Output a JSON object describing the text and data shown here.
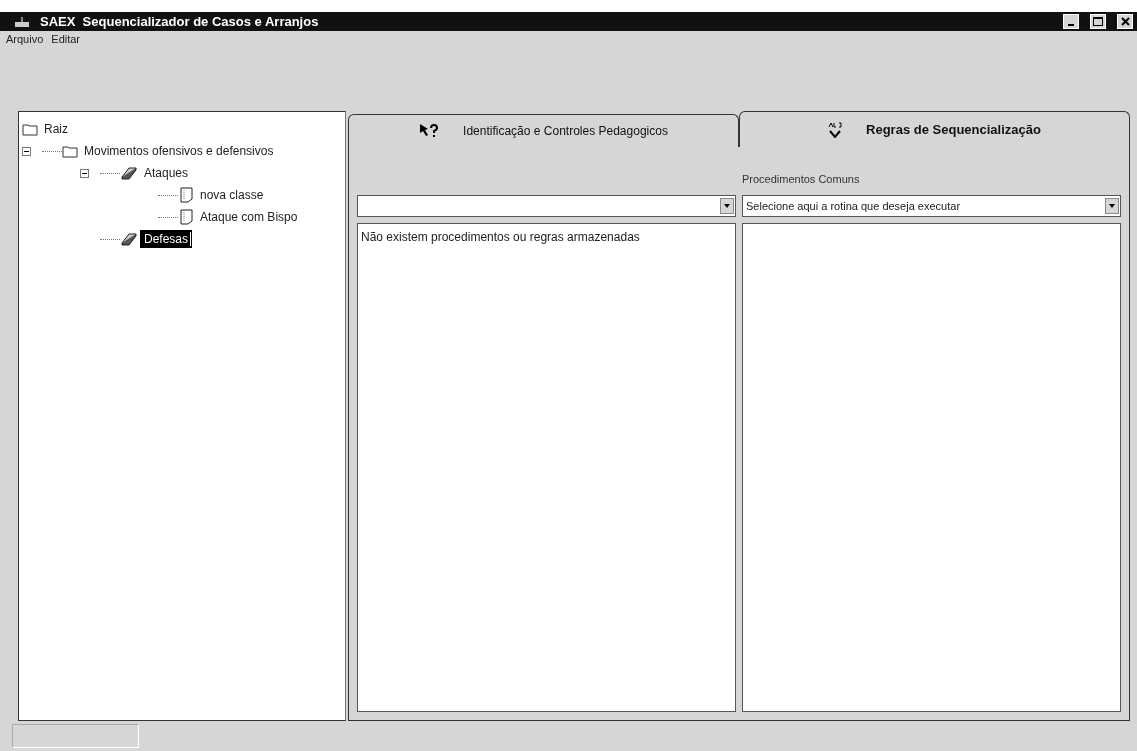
{
  "window": {
    "title": "SAEX  Sequencializador de Casos e Arranjos"
  },
  "menu": [
    "Arquivo",
    "Editar"
  ],
  "tree": [
    {
      "label": "Raiz",
      "kind": "folder",
      "selected": false
    },
    {
      "label": "Movimentos ofensivos e defensivos",
      "kind": "folder",
      "selected": false,
      "expanded": true,
      "children": [
        {
          "label": "Ataques",
          "kind": "category",
          "selected": false,
          "expanded": true,
          "children": [
            {
              "label": "nova classe",
              "kind": "document",
              "selected": false
            },
            {
              "label": "Ataque com Bispo",
              "kind": "document",
              "selected": false
            }
          ]
        },
        {
          "label": "Defesas",
          "kind": "category",
          "selected": true
        }
      ]
    }
  ],
  "tabs": [
    {
      "label": "Identificação e Controles Pedagogicos",
      "kind": "help-pointer",
      "selected": false
    },
    {
      "label": "Regras de Sequencialização",
      "kind": "spellcheck",
      "selected": true
    }
  ],
  "rules_panel": {
    "common_label": "Procedimentos Comuns",
    "right_combo": {
      "value": "Selecione aqui a rotina que deseja executar"
    },
    "left_list": [
      "Não existem procedimentos ou regras armazenadas"
    ]
  }
}
